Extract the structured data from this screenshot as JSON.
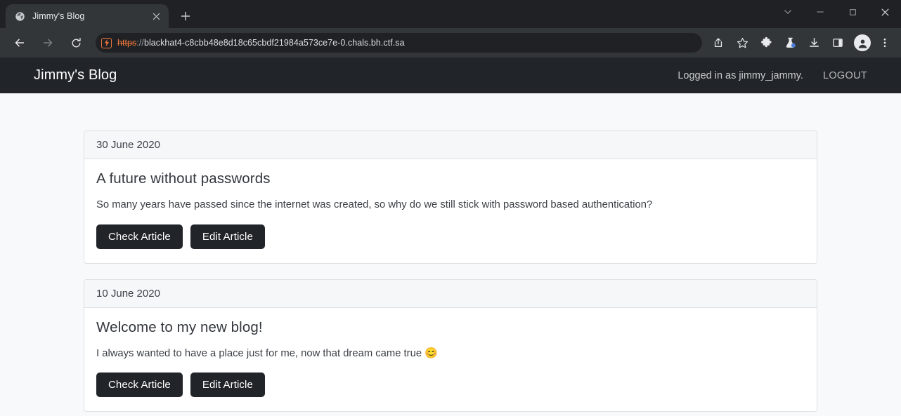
{
  "browser": {
    "tab": {
      "title": "Jimmy's Blog",
      "favicon": "globe-icon",
      "close_label": "×"
    },
    "new_tab_label": "+",
    "window_controls": [
      {
        "name": "tab-search-button",
        "glyph": "∨"
      },
      {
        "name": "minimize-button",
        "glyph": "−"
      },
      {
        "name": "maximize-button",
        "glyph": "□"
      },
      {
        "name": "close-window-button",
        "glyph": "✕"
      }
    ],
    "nav": {
      "back": "back-icon",
      "forward": "forward-icon",
      "reload": "reload-icon"
    },
    "omnibox": {
      "security_state": "not-secure",
      "scheme": "https",
      "separator": "://",
      "host": "blackhat4-c8cbb48e8d18c65cbdf21984a573ce7e-0.chals.bh.ctf.sa",
      "full_url": "https://blackhat4-c8cbb48e8d18c65cbdf21984a573ce7e-0.chals.bh.ctf.sa"
    },
    "toolbar_icons": [
      "share-icon",
      "bookmark-star-icon",
      "extensions-puzzle-icon",
      "experiments-flask-icon",
      "downloads-icon",
      "side-panel-icon",
      "profile-avatar-icon",
      "more-menu-icon"
    ]
  },
  "page": {
    "navbar": {
      "brand": "Jimmy's Blog",
      "user_status": "Logged in as jimmy_jammy.",
      "logout_label": "LOGOUT"
    },
    "articles": [
      {
        "date": "30 June 2020",
        "title": "A future without passwords",
        "text": "So many years have passed since the internet was created, so why do we still stick with password based authentication?",
        "emoji": "",
        "check_label": "Check Article",
        "edit_label": "Edit Article"
      },
      {
        "date": "10 June 2020",
        "title": "Welcome to my new blog!",
        "text": "I always wanted to have a place just for me, now that dream came true ",
        "emoji": "😊",
        "check_label": "Check Article",
        "edit_label": "Edit Article"
      }
    ]
  },
  "colors": {
    "browser_chrome": "#202124",
    "toolbar": "#323639",
    "site_navbar": "#212529",
    "page_background": "#f8f9fa",
    "card_background": "#ffffff",
    "card_header": "#f6f7f8",
    "card_border": "#dfe0e2",
    "button": "#212529",
    "warning_accent": "#e8743b"
  }
}
